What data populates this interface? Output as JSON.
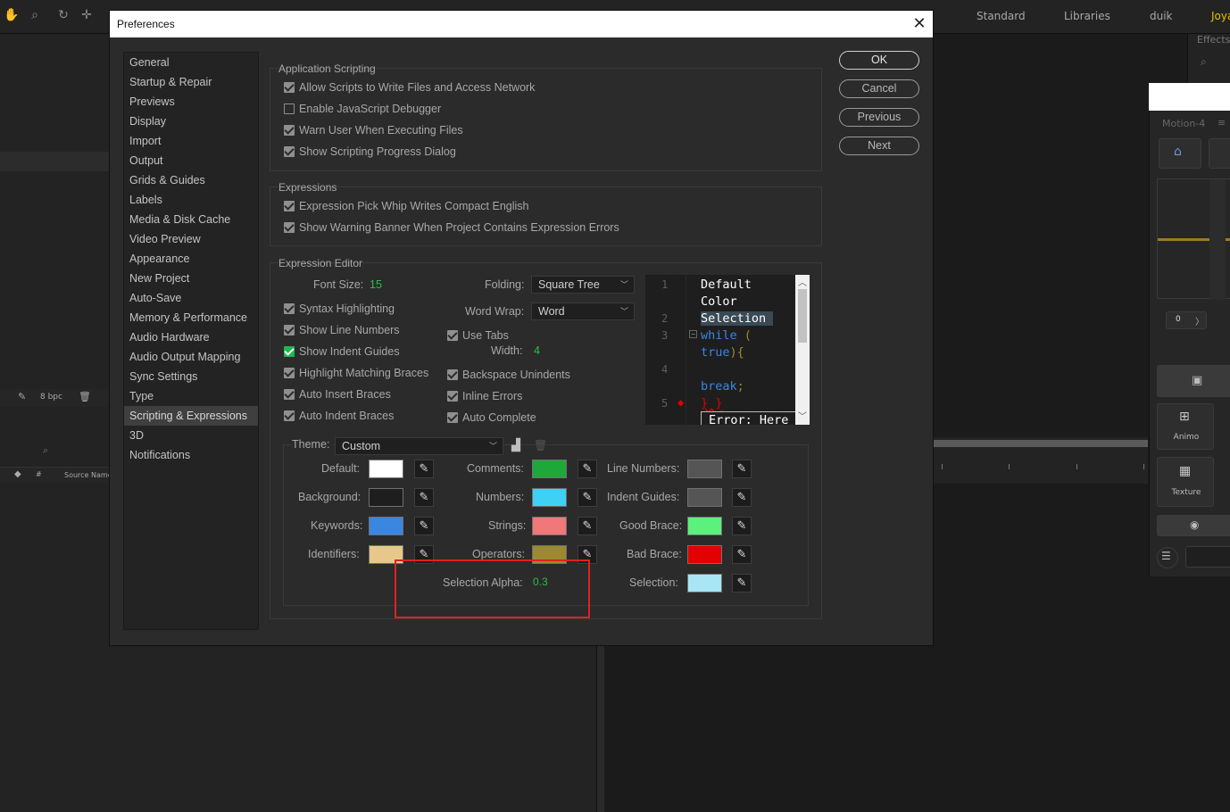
{
  "app": {
    "workspaces": [
      "Standard",
      "Libraries",
      "duik",
      "Joya"
    ],
    "effects_label": "Effects",
    "effects_search_hint": "⌕",
    "bit_depth": "8 bpc",
    "source_name_header": "Source Name",
    "motion_panel": {
      "title": "Motion-4",
      "stepper_value": "0",
      "animo_label": "Animo",
      "texture_label": "Texture"
    }
  },
  "dialog": {
    "title": "Preferences",
    "close_glyph": "✕",
    "categories": [
      "General",
      "Startup & Repair",
      "Previews",
      "Display",
      "Import",
      "Output",
      "Grids & Guides",
      "Labels",
      "Media & Disk Cache",
      "Video Preview",
      "Appearance",
      "New Project",
      "Auto-Save",
      "Memory & Performance",
      "Audio Hardware",
      "Audio Output Mapping",
      "Sync Settings",
      "Type",
      "Scripting & Expressions",
      "3D",
      "Notifications"
    ],
    "selected_category": "Scripting & Expressions",
    "buttons": {
      "ok": "OK",
      "cancel": "Cancel",
      "previous": "Previous",
      "next": "Next"
    }
  },
  "scripting": {
    "title": "Application Scripting",
    "options": [
      {
        "label": "Allow Scripts to Write Files and Access Network",
        "checked": true
      },
      {
        "label": "Enable JavaScript Debugger",
        "checked": false
      },
      {
        "label": "Warn User When Executing Files",
        "checked": true
      },
      {
        "label": "Show Scripting Progress Dialog",
        "checked": true
      }
    ]
  },
  "expressions": {
    "title": "Expressions",
    "options": [
      {
        "label": "Expression Pick Whip Writes Compact English",
        "checked": true
      },
      {
        "label": "Show Warning Banner When Project Contains Expression Errors",
        "checked": true
      }
    ]
  },
  "editor": {
    "title": "Expression Editor",
    "font_size_label": "Font Size:",
    "font_size_value": "15",
    "folding_label": "Folding:",
    "folding_value": "Square Tree",
    "word_wrap_label": "Word Wrap:",
    "word_wrap_value": "Word",
    "use_tabs_label": "Use Tabs",
    "width_label": "Width:",
    "width_value": "4",
    "left_options": [
      {
        "label": "Syntax Highlighting",
        "checked": true
      },
      {
        "label": "Show Line Numbers",
        "checked": true
      },
      {
        "label": "Show Indent Guides",
        "checked": true,
        "accent": true
      },
      {
        "label": "Highlight Matching Braces",
        "checked": true
      },
      {
        "label": "Auto Insert Braces",
        "checked": true
      },
      {
        "label": "Auto Indent Braces",
        "checked": true
      }
    ],
    "right_options": [
      {
        "label": "Backspace Unindents",
        "checked": true
      },
      {
        "label": "Inline Errors",
        "checked": true
      },
      {
        "label": "Auto Complete",
        "checked": true
      }
    ],
    "preview": {
      "line_numbers": [
        "1",
        "2",
        "3",
        "4",
        "5"
      ],
      "line1": "Default",
      "line1b": "Color",
      "line2": "Selection",
      "line3a": "while",
      "line3b": " (",
      "line3c": "true",
      "line3d": "){",
      "line4": "break",
      "line4b": ";",
      "line5": "} }",
      "error": "Error: Here"
    }
  },
  "theme": {
    "label": "Theme:",
    "value": "Custom",
    "colors": {
      "default": {
        "label": "Default:",
        "hex": "#ffffff"
      },
      "background": {
        "label": "Background:",
        "hex": "#1e1e1e"
      },
      "keywords": {
        "label": "Keywords:",
        "hex": "#3a86e0"
      },
      "identifiers": {
        "label": "Identifiers:",
        "hex": "#e6c98a"
      },
      "comments": {
        "label": "Comments:",
        "hex": "#1fa83a"
      },
      "numbers": {
        "label": "Numbers:",
        "hex": "#3fd0f5"
      },
      "strings": {
        "label": "Strings:",
        "hex": "#f07878"
      },
      "operators": {
        "label": "Operators:",
        "hex": "#9a8a32"
      },
      "line_numbers": {
        "label": "Line Numbers:",
        "hex": "#555555"
      },
      "indent_guides": {
        "label": "Indent Guides:",
        "hex": "#555555"
      },
      "good_brace": {
        "label": "Good Brace:",
        "hex": "#5cf07c"
      },
      "bad_brace": {
        "label": "Bad Brace:",
        "hex": "#e30000"
      },
      "selection": {
        "label": "Selection:",
        "hex": "#a8e6f5"
      }
    },
    "selection_alpha_label": "Selection Alpha:",
    "selection_alpha_value": "0.3"
  }
}
